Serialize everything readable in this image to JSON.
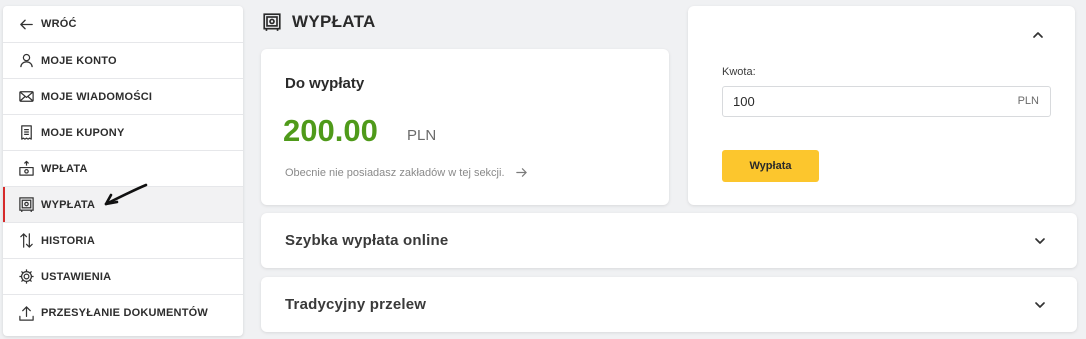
{
  "sidebar": {
    "items": [
      {
        "label": "WRÓĆ",
        "icon": "arrow-left-icon"
      },
      {
        "label": "MOJE KONTO",
        "icon": "user-icon"
      },
      {
        "label": "MOJE WIADOMOŚCI",
        "icon": "envelope-icon"
      },
      {
        "label": "MOJE KUPONY",
        "icon": "receipt-icon"
      },
      {
        "label": "WPŁATA",
        "icon": "deposit-icon"
      },
      {
        "label": "WYPŁATA",
        "icon": "safe-icon",
        "active": true
      },
      {
        "label": "HISTORIA",
        "icon": "arrows-up-down-icon"
      },
      {
        "label": "USTAWIENIA",
        "icon": "gear-icon"
      },
      {
        "label": "PRZESYŁANIE DOKUMENTÓW",
        "icon": "upload-icon"
      }
    ]
  },
  "page": {
    "title": "WYPŁATA",
    "title_icon": "safe-icon"
  },
  "balance": {
    "label": "Do wypłaty",
    "amount": "200.00",
    "currency": "PLN",
    "info": "Obecnie nie posiadasz zakładów w tej sekcji.",
    "info_icon": "arrow-right-icon"
  },
  "withdraw_form": {
    "amount_label": "Kwota:",
    "amount_value": "100",
    "unit": "PLN",
    "button_label": "Wypłata",
    "collapse_icon": "chevron-up-icon"
  },
  "accordions": [
    {
      "label": "Szybka wypłata online",
      "icon": "chevron-down-icon"
    },
    {
      "label": "Tradycyjny przelew",
      "icon": "chevron-down-icon"
    }
  ],
  "colors": {
    "accent_green": "#4f9a1a",
    "button_yellow": "#fcc62d",
    "active_marker": "#d62b2b",
    "background": "#f0f1f3"
  }
}
